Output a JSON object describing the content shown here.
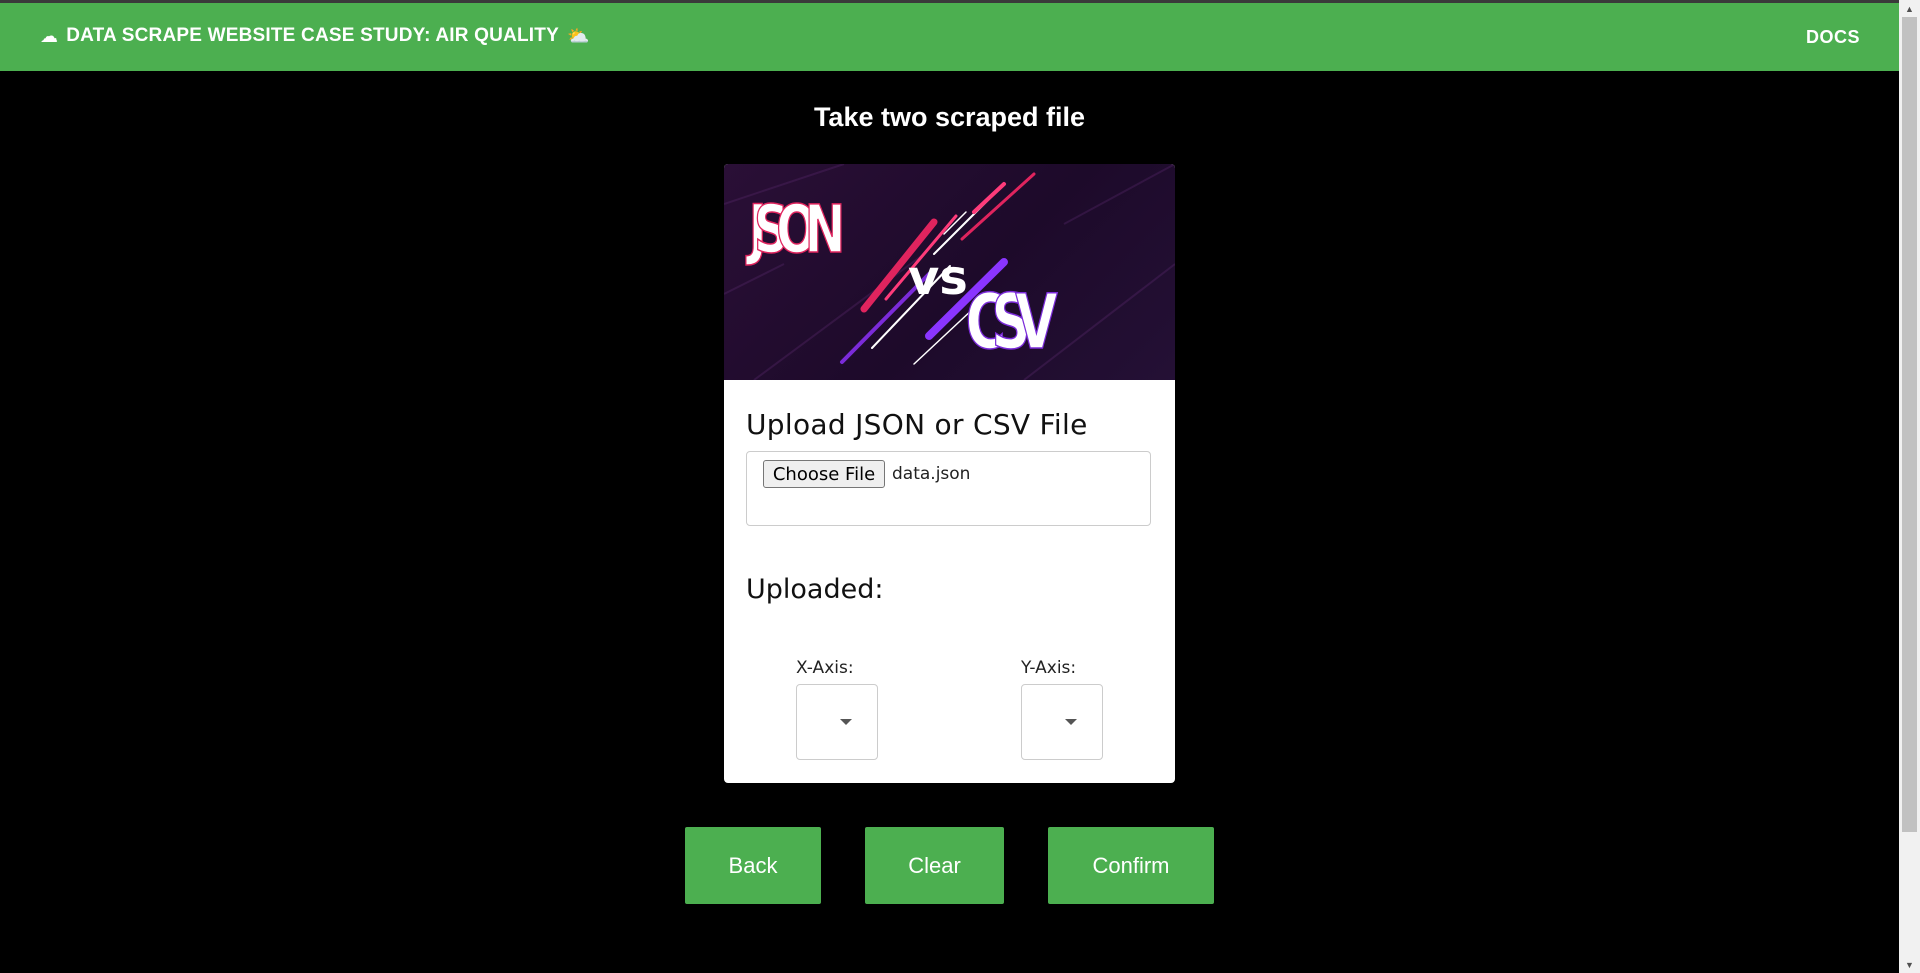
{
  "header": {
    "left_icon": "☁",
    "title": "DATA SCRAPE WEBSITE CASE STUDY: AIR QUALITY",
    "right_icon": "⛅",
    "docs_label": "DOCS"
  },
  "main": {
    "title": "Take two scraped file",
    "banner": {
      "left_text": "JSON",
      "middle_text": "vs",
      "right_text": "CSV"
    },
    "upload_heading": "Upload JSON or CSV File",
    "file_input": {
      "button_label": "Choose File",
      "file_name": "data.json"
    },
    "uploaded_heading": "Uploaded:",
    "x_axis": {
      "label": "X-Axis:",
      "value": ""
    },
    "y_axis": {
      "label": "Y-Axis:",
      "value": ""
    }
  },
  "actions": {
    "back_label": "Back",
    "clear_label": "Clear",
    "confirm_label": "Confirm"
  },
  "colors": {
    "accent": "#4caf50",
    "background": "#000000",
    "card": "#ffffff",
    "banner_bg": "#241035",
    "banner_pink": "#e0245e",
    "banner_purple": "#7b2bd9"
  }
}
